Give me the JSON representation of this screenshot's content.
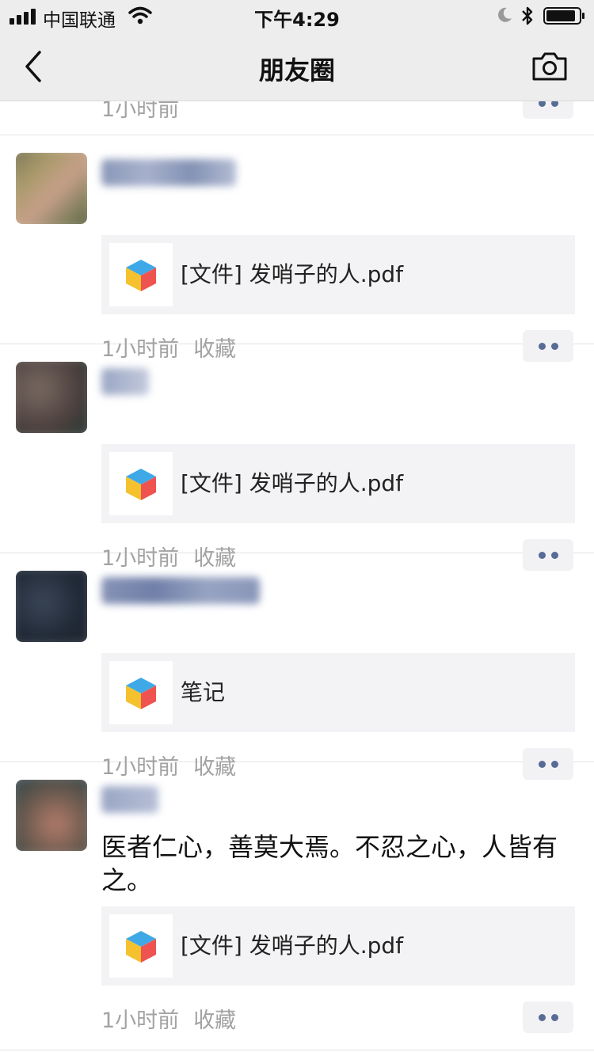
{
  "status_bar": {
    "carrier": "中国联通",
    "time": "下午4:29"
  },
  "nav": {
    "title": "朋友圈"
  },
  "feed": {
    "partial_post": {
      "time": "1小时前"
    },
    "posts": [
      {
        "text": "",
        "card": {
          "title": "[文件] 发哨子的人.pdf"
        },
        "time": "1小时前",
        "fav": "收藏"
      },
      {
        "text": "",
        "card": {
          "title": "[文件] 发哨子的人.pdf"
        },
        "time": "1小时前",
        "fav": "收藏"
      },
      {
        "text": "",
        "card": {
          "title": "笔记"
        },
        "time": "1小时前",
        "fav": "收藏"
      },
      {
        "text": "医者仁心，善莫大焉。不忍之心，人皆有之。",
        "card": {
          "title": "[文件] 发哨子的人.pdf"
        },
        "time": "1小时前",
        "fav": "收藏"
      }
    ]
  },
  "colors": {
    "link_blue": "#576b95",
    "meta_gray": "#a3a3a3",
    "card_bg": "#f3f3f5",
    "nav_bg": "#ededed"
  },
  "icons": [
    "signal-icon",
    "wifi-icon",
    "moon-icon",
    "bluetooth-icon",
    "battery-icon",
    "back-chevron-icon",
    "camera-icon",
    "file-cube-icon",
    "more-dots-icon"
  ]
}
